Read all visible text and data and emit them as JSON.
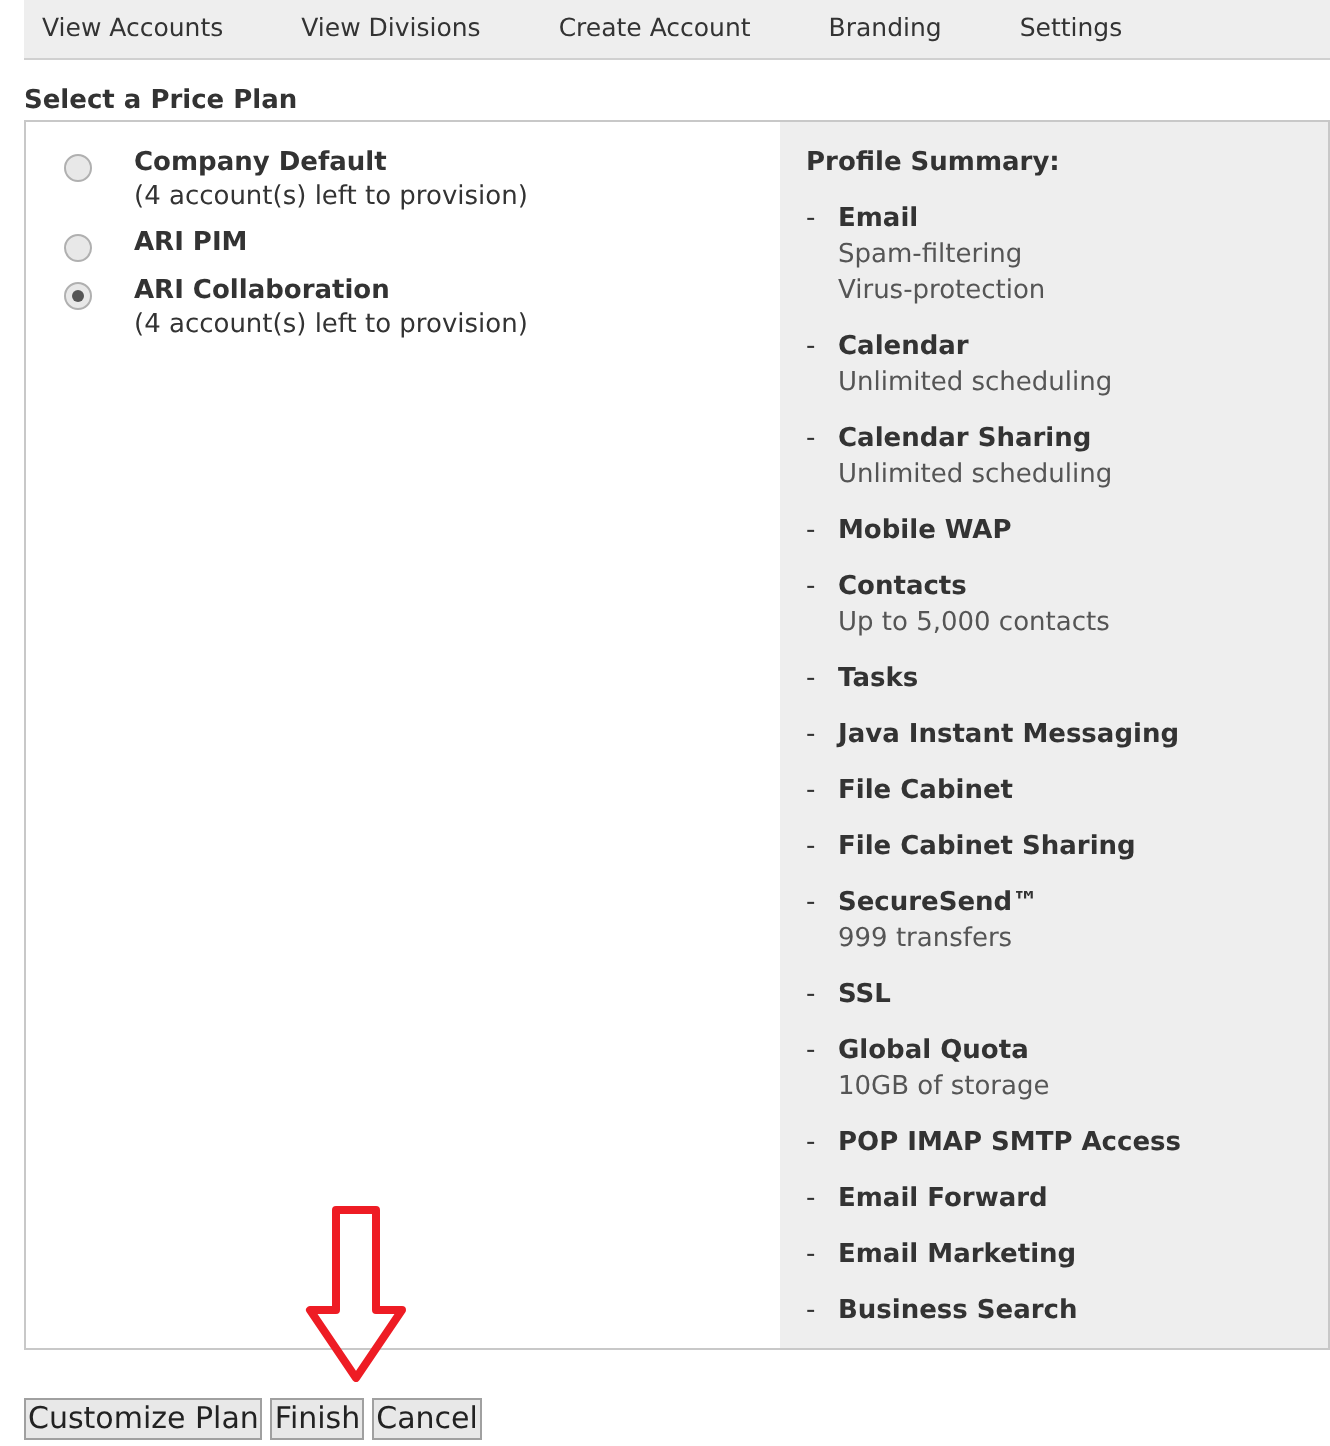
{
  "nav": [
    "View Accounts",
    "View Divisions",
    "Create Account",
    "Branding",
    "Settings"
  ],
  "section_title": "Select a Price Plan",
  "plans": [
    {
      "name": "Company Default",
      "note": "(4 account(s) left to provision)",
      "selected": false
    },
    {
      "name": "ARI PIM",
      "selected": false
    },
    {
      "name": "ARI Collaboration",
      "note": "(4 account(s) left to provision)",
      "selected": true
    }
  ],
  "summary": {
    "title": "Profile Summary:",
    "items": [
      {
        "bullet": "-",
        "name": "Email",
        "details": [
          "Spam-filtering",
          "Virus-protection"
        ]
      },
      {
        "bullet": "-",
        "name": "Calendar",
        "details": [
          "Unlimited scheduling"
        ]
      },
      {
        "bullet": "-",
        "name": "Calendar Sharing",
        "details": [
          "Unlimited scheduling"
        ]
      },
      {
        "bullet": "-",
        "name": "Mobile WAP"
      },
      {
        "bullet": "-",
        "name": "Contacts",
        "details": [
          "Up to 5,000 contacts"
        ]
      },
      {
        "bullet": "-",
        "name": "Tasks"
      },
      {
        "bullet": "-",
        "name": "Java Instant Messaging"
      },
      {
        "bullet": "-",
        "name": "File Cabinet"
      },
      {
        "bullet": "-",
        "name": "File Cabinet Sharing"
      },
      {
        "bullet": "-",
        "name": "SecureSend™",
        "details": [
          "999 transfers"
        ]
      },
      {
        "bullet": "-",
        "name": "SSL"
      },
      {
        "bullet": "-",
        "name": "Global Quota",
        "details": [
          "10GB of storage"
        ]
      },
      {
        "bullet": "-",
        "name": "POP IMAP SMTP Access"
      },
      {
        "bullet": "-",
        "name": "Email Forward"
      },
      {
        "bullet": "-",
        "name": "Email Marketing"
      },
      {
        "bullet": "-",
        "name": "Business Search"
      }
    ]
  },
  "buttons": [
    "Customize Plan",
    "Finish",
    "Cancel"
  ]
}
